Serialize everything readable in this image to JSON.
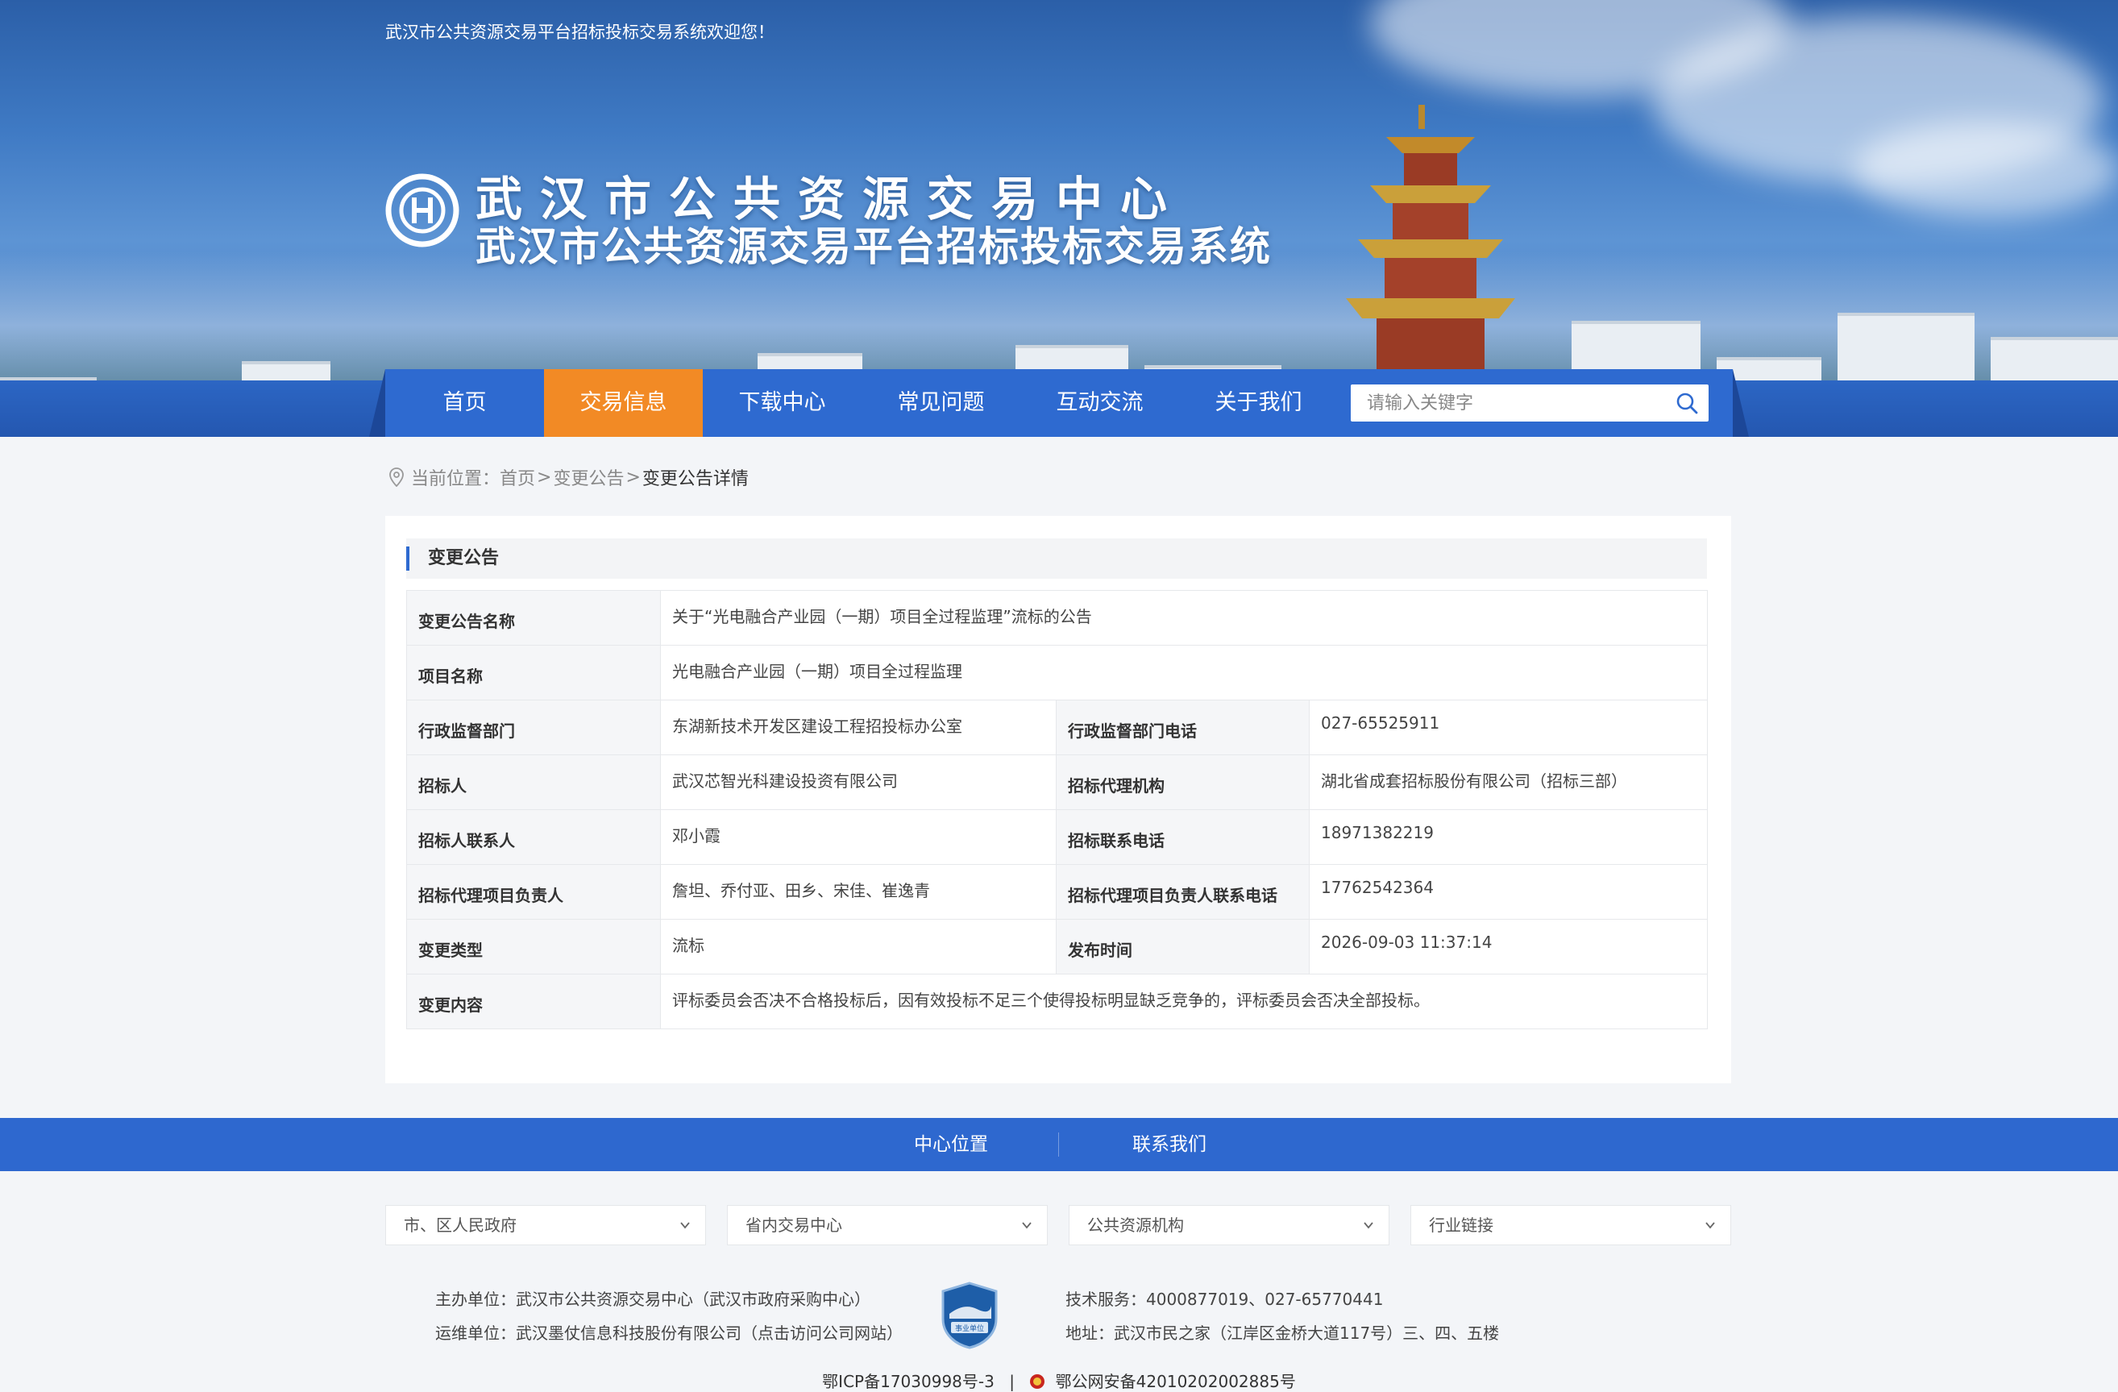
{
  "header": {
    "welcome": "武汉市公共资源交易平台招标投标交易系统欢迎您！",
    "title_line1": "武汉市公共资源交易中心",
    "title_line2": "武汉市公共资源交易平台招标投标交易系统"
  },
  "nav": {
    "items": [
      {
        "label": "首页",
        "active": false
      },
      {
        "label": "交易信息",
        "active": true
      },
      {
        "label": "下载中心",
        "active": false
      },
      {
        "label": "常见问题",
        "active": false
      },
      {
        "label": "互动交流",
        "active": false
      },
      {
        "label": "关于我们",
        "active": false
      }
    ],
    "search_placeholder": "请输入关键字"
  },
  "breadcrumb": {
    "prefix": "当前位置：",
    "home": "首页",
    "sep": ">",
    "section": "变更公告",
    "current": "变更公告详情"
  },
  "panel": {
    "title": "变更公告",
    "rows": {
      "name_label": "变更公告名称",
      "name_value": "关于“光电融合产业园（一期）项目全过程监理”流标的公告",
      "project_label": "项目名称",
      "project_value": "光电融合产业园（一期）项目全过程监理",
      "dept_label": "行政监督部门",
      "dept_value": "东湖新技术开发区建设工程招投标办公室",
      "dept_phone_label": "行政监督部门电话",
      "dept_phone_value": "027-65525911",
      "bidder_label": "招标人",
      "bidder_value": "武汉芯智光科建设投资有限公司",
      "agency_label": "招标代理机构",
      "agency_value": "湖北省成套招标股份有限公司（招标三部）",
      "contact_label": "招标人联系人",
      "contact_value": "邓小霞",
      "contact_phone_label": "招标联系电话",
      "contact_phone_value": "18971382219",
      "agent_lead_label": "招标代理项目负责人",
      "agent_lead_value": "詹坦、乔付亚、田乡、宋佳、崔逸青",
      "agent_lead_phone_label": "招标代理项目负责人联系电话",
      "agent_lead_phone_value": "17762542364",
      "change_type_label": "变更类型",
      "change_type_value": "流标",
      "publish_time_label": "发布时间",
      "publish_time_value": "2026-09-03 11:37:14",
      "change_content_label": "变更内容",
      "change_content_value": "评标委员会否决不合格投标后，因有效投标不足三个使得投标明显缺乏竞争的，评标委员会否决全部投标。"
    }
  },
  "footer": {
    "links": [
      "中心位置",
      "联系我们"
    ],
    "selects": [
      "市、区人民政府",
      "省内交易中心",
      "公共资源机构",
      "行业链接"
    ],
    "sponsor": "主办单位：武汉市公共资源交易中心（武汉市政府采购中心）",
    "operator": "运维单位：武汉墨仗信息科技股份有限公司（点击访问公司网站）",
    "tech": "技术服务：4000877019、027-65770441",
    "address": "地址：武汉市民之家（江岸区金桥大道117号）三、四、五楼",
    "badge_text": "事业单位",
    "icp": "鄂ICP备17030998号-3",
    "icp_sep": "|",
    "police": "鄂公网安备42010202002885号"
  },
  "colors": {
    "nav_blue": "#2e6ad0",
    "active_orange": "#f28a25",
    "highlight_red": "#e02b2b"
  }
}
